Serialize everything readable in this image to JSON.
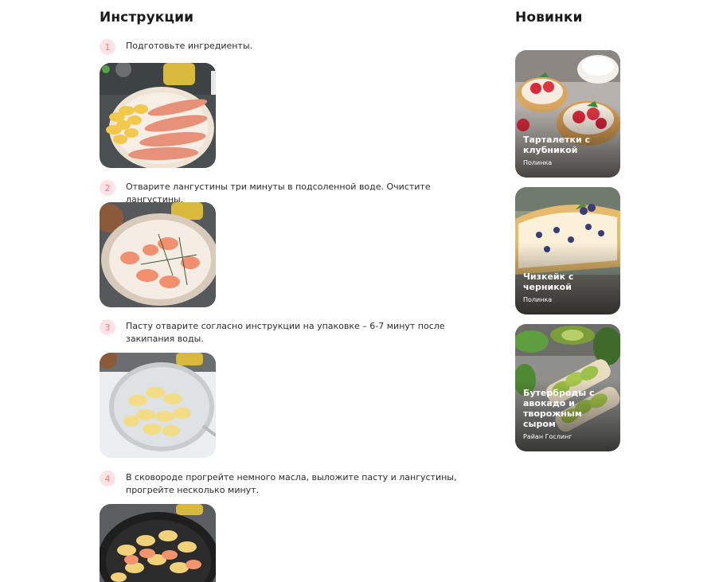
{
  "instructions": {
    "title": "Инструкции",
    "steps": [
      {
        "number": "1",
        "text": "Подготовьте ингредиенты.",
        "image_icon": "raw-langoustines-and-pasta-photo"
      },
      {
        "number": "2",
        "text": "Отварите лангустины три минуты в подсоленной воде. Очистите лангустины.",
        "image_icon": "peeled-langoustines-plate-photo"
      },
      {
        "number": "3",
        "text": "Пасту отварите согласно инструкции на упаковке – 6-7 минут после закипания воды.",
        "image_icon": "pasta-in-strainer-photo"
      },
      {
        "number": "4",
        "text": "В сковороде прогрейте немного масла, выложите пасту и лангустины, прогрейте несколько минут.",
        "image_icon": "pasta-in-pan-photo"
      }
    ]
  },
  "sidebar": {
    "title": "Новинки",
    "cards": [
      {
        "title": "Тарталетки с клубникой",
        "author": "Полинка",
        "image_icon": "strawberry-tartlets-photo"
      },
      {
        "title": "Чизкейк с черникой",
        "author": "Полинка",
        "image_icon": "blueberry-cheesecake-photo"
      },
      {
        "title": "Бутерброды с авокадо и творожным сыром",
        "author": "Райан Гослинг",
        "image_icon": "avocado-sandwiches-photo"
      }
    ]
  },
  "colors": {
    "step_badge_bg": "#fde3e6",
    "step_badge_text": "#f07a88",
    "text": "#1c1c1c"
  }
}
